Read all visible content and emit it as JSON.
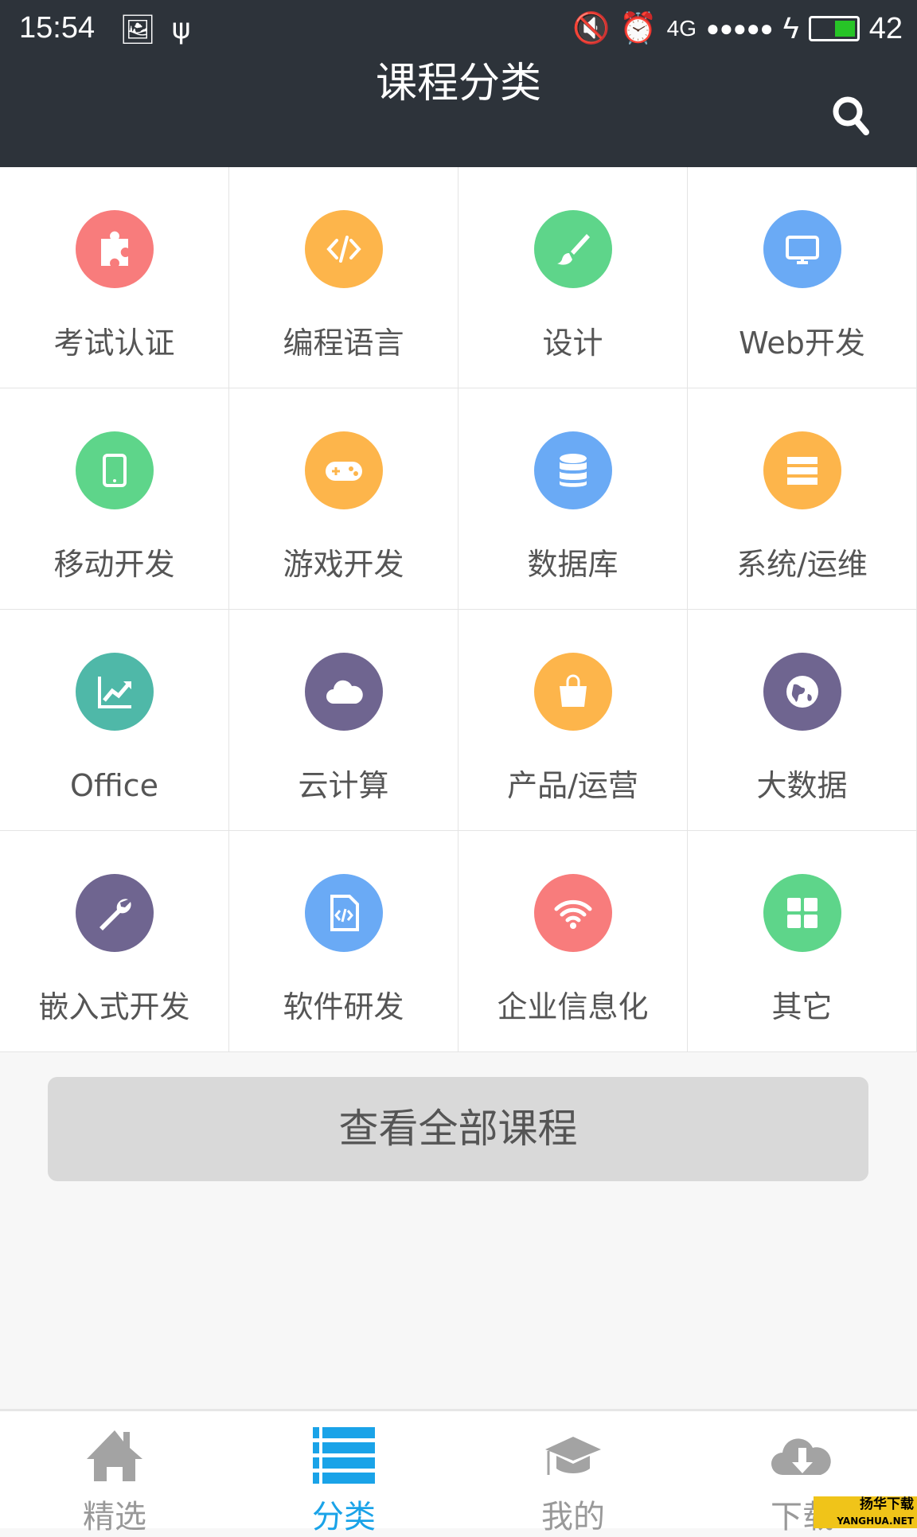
{
  "status_bar": {
    "time": "15:54",
    "network": "4G",
    "battery": "42",
    "battery_level": 0.42
  },
  "header": {
    "title": "课程分类",
    "search_icon": "search-icon"
  },
  "colors": {
    "header_bg": "#2d333a",
    "accent": "#1aa3e8",
    "red": "#f87c7c",
    "orange": "#fdb54b",
    "green": "#5ed58a",
    "blue": "#6aaaf5",
    "teal": "#4fb8a8",
    "purple": "#6f6590"
  },
  "categories": [
    {
      "label": "考试认证",
      "icon": "puzzle-icon",
      "color": "#f87c7c"
    },
    {
      "label": "编程语言",
      "icon": "code-icon",
      "color": "#fdb54b"
    },
    {
      "label": "设计",
      "icon": "brush-icon",
      "color": "#5ed58a"
    },
    {
      "label": "Web开发",
      "icon": "monitor-icon",
      "color": "#6aaaf5"
    },
    {
      "label": "移动开发",
      "icon": "tablet-icon",
      "color": "#5ed58a"
    },
    {
      "label": "游戏开发",
      "icon": "gamepad-icon",
      "color": "#fdb54b"
    },
    {
      "label": "数据库",
      "icon": "database-icon",
      "color": "#6aaaf5"
    },
    {
      "label": "系统/运维",
      "icon": "server-icon",
      "color": "#fdb54b"
    },
    {
      "label": "Office",
      "icon": "chart-icon",
      "color": "#4fb8a8"
    },
    {
      "label": "云计算",
      "icon": "cloud-icon",
      "color": "#6f6590"
    },
    {
      "label": "产品/运营",
      "icon": "shopping-bag-icon",
      "color": "#fdb54b"
    },
    {
      "label": "大数据",
      "icon": "globe-icon",
      "color": "#6f6590"
    },
    {
      "label": "嵌入式开发",
      "icon": "wrench-icon",
      "color": "#6f6590"
    },
    {
      "label": "软件研发",
      "icon": "code-file-icon",
      "color": "#6aaaf5"
    },
    {
      "label": "企业信息化",
      "icon": "wifi-icon",
      "color": "#f87c7c"
    },
    {
      "label": "其它",
      "icon": "grid-icon",
      "color": "#5ed58a"
    }
  ],
  "all_courses_label": "查看全部课程",
  "nav": [
    {
      "label": "精选",
      "icon": "home-icon",
      "active": false
    },
    {
      "label": "分类",
      "icon": "list-icon",
      "active": true
    },
    {
      "label": "我的",
      "icon": "graduation-cap-icon",
      "active": false
    },
    {
      "label": "下载",
      "icon": "cloud-download-icon",
      "active": false
    }
  ],
  "watermark": {
    "text": "扬华下载",
    "sub": "YANGHUA.NET"
  }
}
